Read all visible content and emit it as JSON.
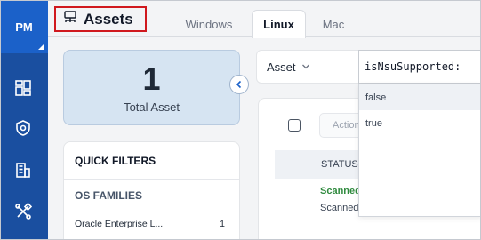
{
  "sidebar": {
    "brand": "PM",
    "items": [
      {
        "icon": "dashboard-icon"
      },
      {
        "icon": "shield-icon"
      },
      {
        "icon": "building-icon"
      },
      {
        "icon": "tools-icon"
      }
    ]
  },
  "header": {
    "title": "Assets",
    "title_icon": "network-icon",
    "tabs": [
      {
        "label": "Windows",
        "active": false
      },
      {
        "label": "Linux",
        "active": true
      },
      {
        "label": "Mac",
        "active": false
      }
    ]
  },
  "summary": {
    "total_count": "1",
    "total_label": "Total Asset"
  },
  "quick_filters": {
    "title": "QUICK FILTERS",
    "section": "OS FAMILIES",
    "items": [
      {
        "label": "Oracle Enterprise L...",
        "count": "1"
      }
    ]
  },
  "toolbar": {
    "select_value": "Asset",
    "action_label": "Action",
    "filter_value": "isNsuSupported:"
  },
  "filter_suggestions": [
    "false",
    "true"
  ],
  "table": {
    "status_header": "STATUS",
    "rows": [
      {
        "status": "Scanned",
        "status_sub": "Scanned"
      }
    ]
  },
  "colors": {
    "sidebar": "#1a4fa0",
    "brand_tile": "#1b61c9",
    "title_highlight": "#d0181e",
    "status_success": "#2f8a3e"
  }
}
